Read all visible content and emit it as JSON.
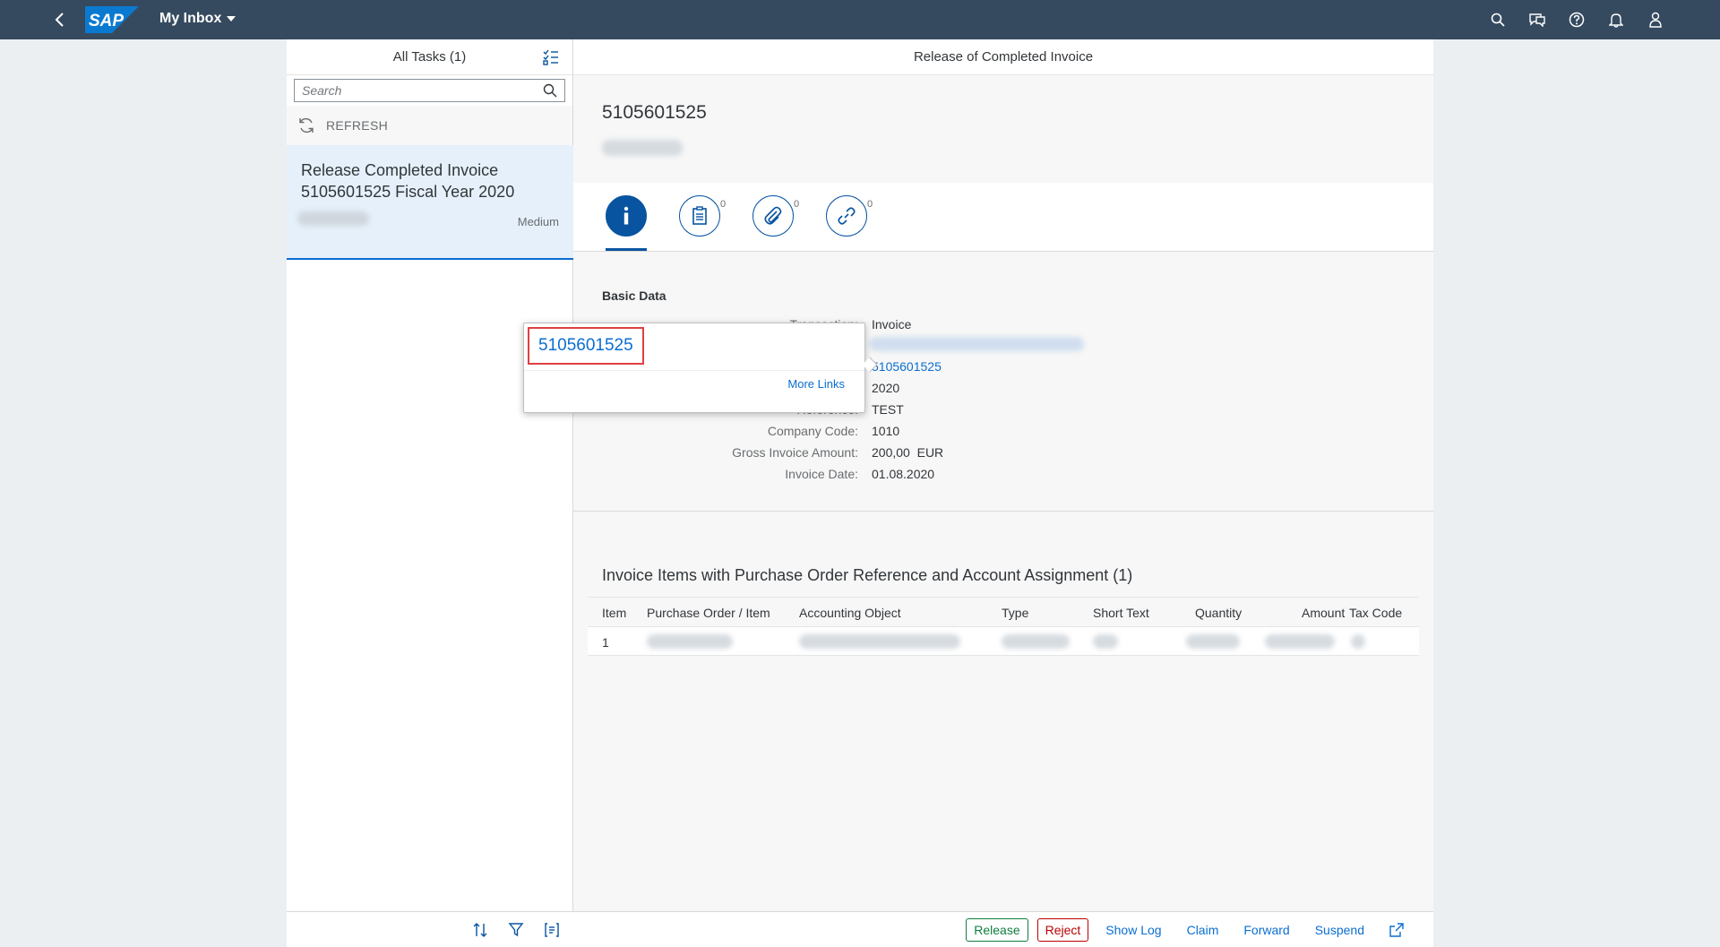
{
  "shell": {
    "title": "My Inbox",
    "logo_text": "SAP"
  },
  "master": {
    "header": "All Tasks (1)",
    "search_placeholder": "Search",
    "refresh_label": "REFRESH",
    "tasks": [
      {
        "title": "Release Completed Invoice 5105601525 Fiscal Year 2020",
        "priority": "Medium"
      }
    ]
  },
  "detail": {
    "header": "Release of Completed Invoice",
    "object_title": "5105601525",
    "tabs": [
      {
        "icon": "info-icon",
        "count": ""
      },
      {
        "icon": "notes-icon",
        "count": "0"
      },
      {
        "icon": "attachment-icon",
        "count": "0"
      },
      {
        "icon": "link-icon",
        "count": "0"
      }
    ],
    "basic_data": {
      "title": "Basic Data",
      "transaction_label": "Transaction:",
      "transaction_value": "Invoice",
      "invoice_number": "5105601525",
      "fiscal_year_value": "2020",
      "reference_label": "Reference:",
      "reference_value": "TEST",
      "company_code_label": "Company Code:",
      "company_code_value": "1010",
      "gross_amount_label": "Gross Invoice Amount:",
      "gross_amount_value": "200,00",
      "currency": "EUR",
      "invoice_date_label": "Invoice Date:",
      "invoice_date_value": "01.08.2020"
    },
    "items_table": {
      "title": "Invoice Items with Purchase Order Reference and Account Assignment (1)",
      "columns": [
        "Item",
        "Purchase Order / Item",
        "Accounting Object",
        "Type",
        "Short Text",
        "Quantity",
        "Amount",
        "Tax Code"
      ],
      "rows": [
        {
          "item": "1"
        }
      ]
    },
    "footer": {
      "release": "Release",
      "reject": "Reject",
      "show_log": "Show Log",
      "claim": "Claim",
      "forward": "Forward",
      "suspend": "Suspend"
    }
  },
  "popover": {
    "link": "5105601525",
    "more_links": "More Links"
  },
  "colors": {
    "shell_bg": "#354a5f",
    "accent": "#0a6ed1",
    "accept": "#107e3e",
    "reject": "#bb0000",
    "highlight": "#e04040"
  }
}
